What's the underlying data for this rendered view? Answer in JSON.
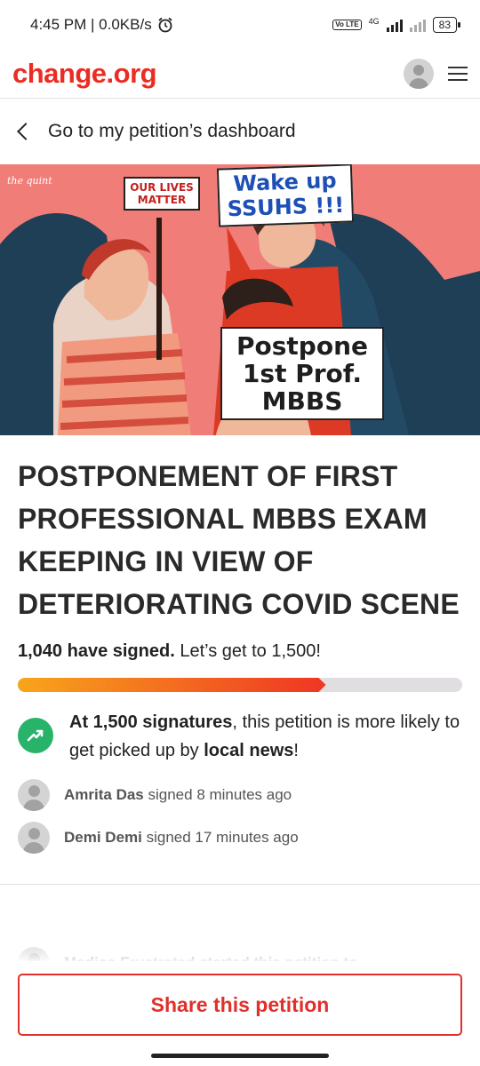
{
  "status_bar": {
    "time_speed": "4:45 PM | 0.0KB/s",
    "alarm_icon": "alarm-clock-icon",
    "volte": "Vo LTE",
    "network": "4G",
    "battery": "83"
  },
  "header": {
    "logo": "change.org",
    "avatar_icon": "user-avatar-icon",
    "menu_icon": "hamburger-menu-icon"
  },
  "nav": {
    "back_label": "Go to my petition’s dashboard"
  },
  "hero": {
    "watermark": "the quint",
    "sign_left": "OUR LIVES MATTER",
    "sign_top": "Wake up SSUHS !!!",
    "sign_bottom": "Postpone 1st Prof. MBBS"
  },
  "petition": {
    "title": "POSTPONEMENT OF FIRST PROFESSIONAL MBBS EXAM KEEPING IN VIEW OF DETERIORATING COVID SCENE",
    "signed_count": "1,040 have signed.",
    "goal_text": "Let’s get to 1,500!",
    "progress_fraction": 0.693
  },
  "milestone": {
    "icon": "trending-up-icon",
    "bold_start": "At 1,500 signatures",
    "middle": ", this petition is more likely to get picked up by ",
    "bold_end": "local news",
    "end": "!"
  },
  "signers": [
    {
      "name": "Amrita Das",
      "action": "signed 8 minutes ago"
    },
    {
      "name": "Demi Demi",
      "action": "signed 17 minutes ago"
    }
  ],
  "peek_text": "Medico Frustrated started this petition to",
  "cta": {
    "share_label": "Share this petition"
  }
}
